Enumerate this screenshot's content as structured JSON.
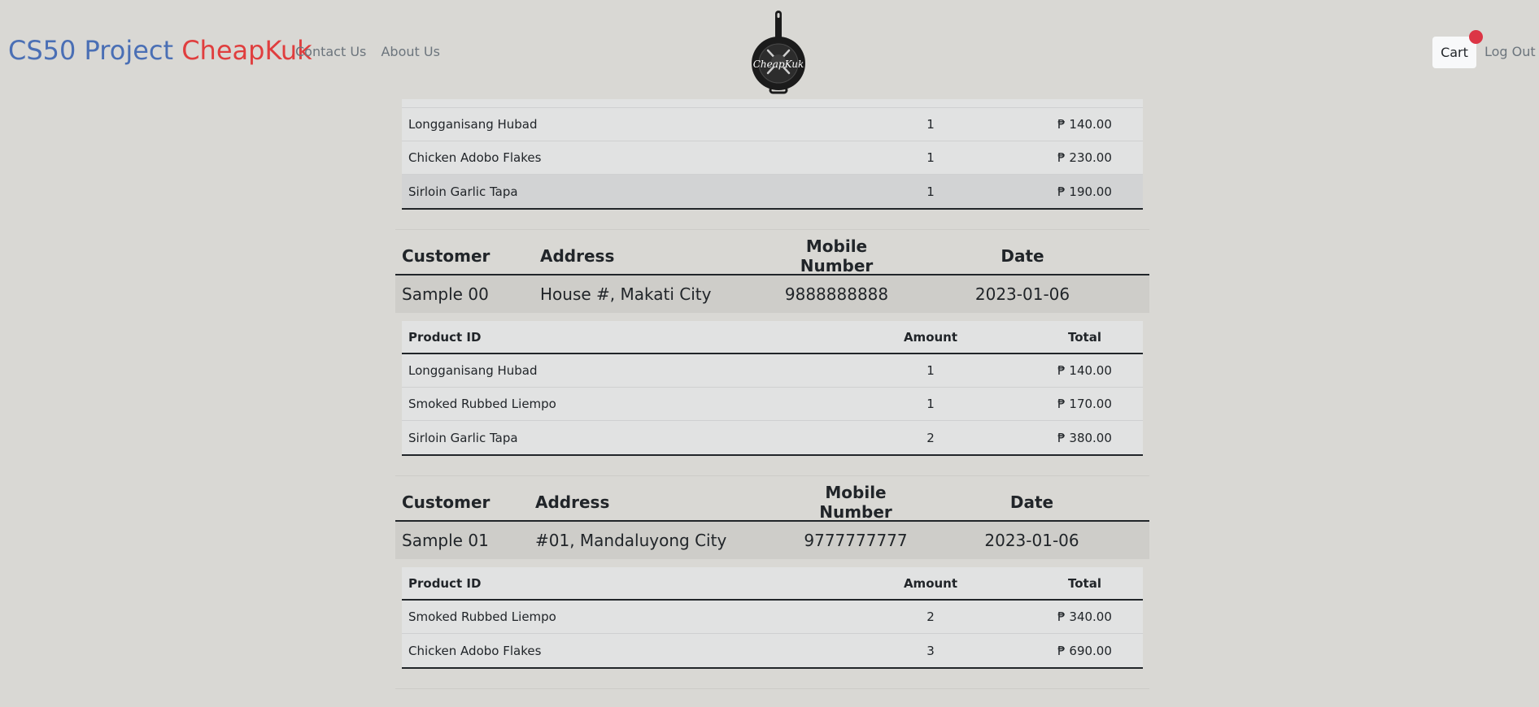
{
  "brand": {
    "part1": "CS50 Project",
    "part2": "CheapKuk"
  },
  "nav": {
    "contact": "Contact Us",
    "about": "About Us"
  },
  "logo": {
    "text": "CheapKuk"
  },
  "actions": {
    "cart": "Cart",
    "logout": "Log Out"
  },
  "colors": {
    "brand_blue": "#4a6fb5",
    "brand_red": "#e03e3e",
    "badge": "#dc3545",
    "background": "#d9d8d4"
  },
  "first_order_items": [
    {
      "product": "Longganisang Hubad",
      "amount": "1",
      "total": "₱ 140.00"
    },
    {
      "product": "Chicken Adobo Flakes",
      "amount": "1",
      "total": "₱ 230.00"
    },
    {
      "product": "Sirloin Garlic Tapa",
      "amount": "1",
      "total": "₱ 190.00"
    }
  ],
  "order_headers": {
    "customer": "Customer",
    "address": "Address",
    "mobile": "Mobile Number",
    "date": "Date"
  },
  "item_headers": {
    "product": "Product ID",
    "amount": "Amount",
    "total": "Total"
  },
  "orders": [
    {
      "customer": "Sample 00",
      "address": "House #, Makati City",
      "mobile": "9888888888",
      "date": "2023-01-06",
      "items": [
        {
          "product": "Longganisang Hubad",
          "amount": "1",
          "total": "₱ 140.00"
        },
        {
          "product": "Smoked Rubbed Liempo",
          "amount": "1",
          "total": "₱ 170.00"
        },
        {
          "product": "Sirloin Garlic Tapa",
          "amount": "2",
          "total": "₱ 380.00"
        }
      ]
    },
    {
      "customer": "Sample 01",
      "address": "#01, Mandaluyong City",
      "mobile": "9777777777",
      "date": "2023-01-06",
      "items": [
        {
          "product": "Smoked Rubbed Liempo",
          "amount": "2",
          "total": "₱ 340.00"
        },
        {
          "product": "Chicken Adobo Flakes",
          "amount": "3",
          "total": "₱ 690.00"
        }
      ]
    }
  ]
}
